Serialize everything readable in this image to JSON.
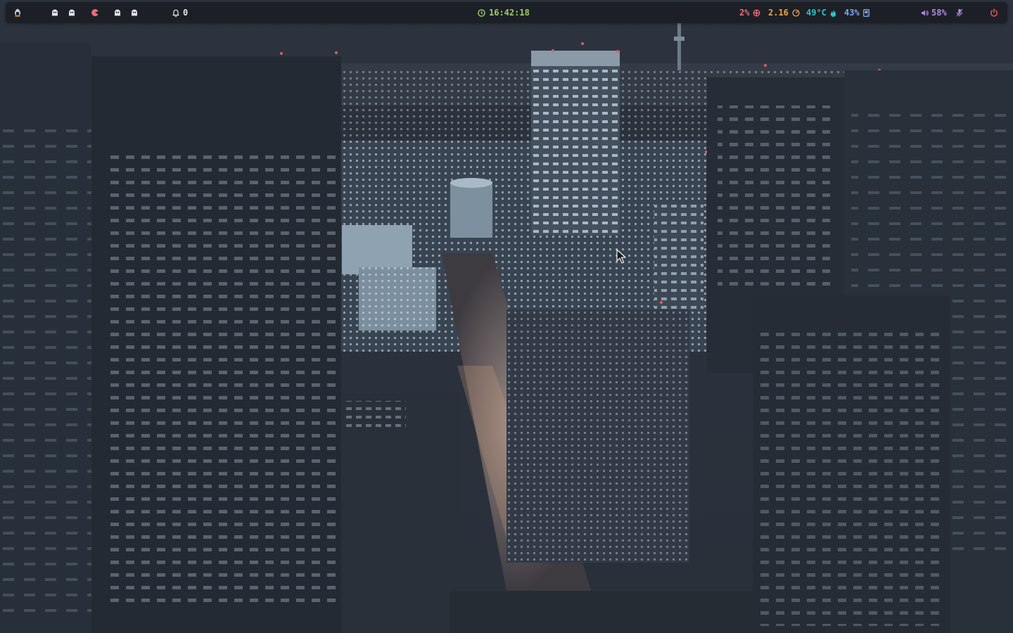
{
  "desktop": {
    "wallpaper": "night-city-aerial"
  },
  "topbar": {
    "distro_icon": "tux-penguin-icon",
    "workspaces": [
      {
        "icon": "ghost-icon",
        "state": "occupied"
      },
      {
        "icon": "ghost-icon",
        "state": "occupied"
      },
      {
        "icon": "pacman-icon",
        "state": "active"
      },
      {
        "icon": "ghost-icon",
        "state": "occupied"
      },
      {
        "icon": "ghost-icon",
        "state": "occupied"
      }
    ],
    "notifications": {
      "icon": "bell-icon",
      "count": "0"
    },
    "clock": {
      "icon": "clock-icon",
      "time": "16:42:18"
    },
    "cpu": {
      "value": "2%",
      "icon": "cpu-icon"
    },
    "load": {
      "value": "2.16",
      "icon": "gauge-icon"
    },
    "temperature": {
      "value": "49°C",
      "icon": "flame-icon"
    },
    "disk": {
      "value": "43%",
      "icon": "disk-icon"
    },
    "volume": {
      "icon": "speaker-icon",
      "value": "58%"
    },
    "microphone": {
      "icon": "microphone-icon"
    },
    "power": {
      "icon": "power-icon"
    }
  },
  "colors": {
    "bar_bg": "#1c2026",
    "workspace": "#e6e6e6",
    "workspace_active": "#ef6b7b",
    "clock": "#9ccc65",
    "cpu": "#ef6b7b",
    "load": "#f0a34a",
    "temperature": "#26c6c9",
    "disk": "#7aa6f0",
    "volume": "#b38ae0",
    "power": "#e5534b"
  }
}
